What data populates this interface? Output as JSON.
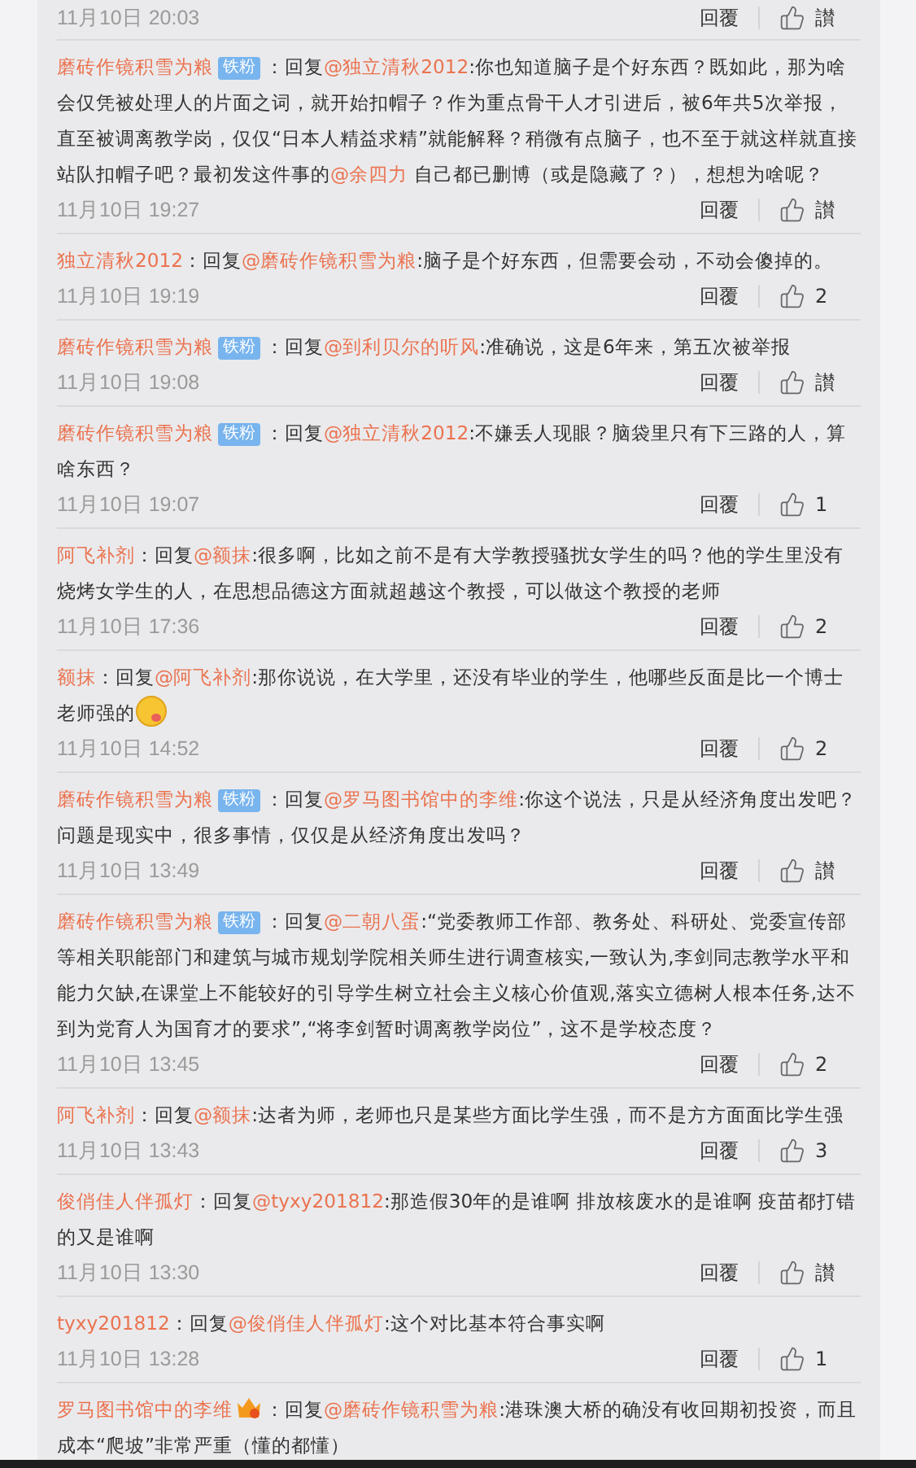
{
  "partial_footer": {
    "date": "11月10日 20:03",
    "reply": "回覆",
    "likes": "讃"
  },
  "comments": [
    {
      "user": "磨砖作镜积雪为粮",
      "badge": {
        "kind": "fan",
        "label": "铁粉"
      },
      "prefix": "：回复",
      "parts": [
        {
          "kind": "mention",
          "text": "@独立清秋2012"
        },
        {
          "kind": "text",
          "text": ":你也知道脑子是个好东西？既如此，那为啥会仅凭被处理人的片面之词，就开始扣帽子？作为重点骨干人才引进后，被6年共5次举报，直至被调离教学岗，仅仅“日本人精益求精”就能解释？稍微有点脑子，也不至于就这样就直接站队扣帽子吧？最初发这件事的"
        },
        {
          "kind": "mention",
          "text": "@余四力"
        },
        {
          "kind": "text",
          "text": " 自己都已删博（或是隐藏了？），想想为啥呢？"
        }
      ],
      "date": "11月10日 19:27",
      "reply": "回覆",
      "likes": "讃"
    },
    {
      "user": "独立清秋2012",
      "prefix": "：回复",
      "parts": [
        {
          "kind": "mention",
          "text": "@磨砖作镜积雪为粮"
        },
        {
          "kind": "text",
          "text": ":脑子是个好东西，但需要会动，不动会傻掉的。"
        }
      ],
      "date": "11月10日 19:19",
      "reply": "回覆",
      "likes": "2"
    },
    {
      "user": "磨砖作镜积雪为粮",
      "badge": {
        "kind": "fan",
        "label": "铁粉"
      },
      "prefix": "：回复",
      "parts": [
        {
          "kind": "mention",
          "text": "@到利贝尔的听风"
        },
        {
          "kind": "text",
          "text": ":准确说，这是6年来，第五次被举报"
        }
      ],
      "date": "11月10日 19:08",
      "reply": "回覆",
      "likes": "讃"
    },
    {
      "user": "磨砖作镜积雪为粮",
      "badge": {
        "kind": "fan",
        "label": "铁粉"
      },
      "prefix": "：回复",
      "parts": [
        {
          "kind": "mention",
          "text": "@独立清秋2012"
        },
        {
          "kind": "text",
          "text": ":不嫌丢人现眼？脑袋里只有下三路的人，算啥东西？"
        }
      ],
      "date": "11月10日 19:07",
      "reply": "回覆",
      "likes": "1"
    },
    {
      "user": "阿飞补剂",
      "prefix": "：回复",
      "parts": [
        {
          "kind": "mention",
          "text": "@额抹"
        },
        {
          "kind": "text",
          "text": ":很多啊，比如之前不是有大学教授骚扰女学生的吗？他的学生里没有烧烤女学生的人，在思想品德这方面就超越这个教授，可以做这个教授的老师"
        }
      ],
      "date": "11月10日 17:36",
      "reply": "回覆",
      "likes": "2"
    },
    {
      "user": "额抹",
      "prefix": "：回复",
      "parts": [
        {
          "kind": "mention",
          "text": "@阿飞补剂"
        },
        {
          "kind": "text",
          "text": ":那你说说，在大学里，还没有毕业的学生，他哪些反面是比一个博士老师强的"
        },
        {
          "kind": "emoji"
        }
      ],
      "date": "11月10日 14:52",
      "reply": "回覆",
      "likes": "2"
    },
    {
      "user": "磨砖作镜积雪为粮",
      "badge": {
        "kind": "fan",
        "label": "铁粉"
      },
      "prefix": "：回复",
      "parts": [
        {
          "kind": "mention",
          "text": "@罗马图书馆中的李维"
        },
        {
          "kind": "text",
          "text": ":你这个说法，只是从经济角度出发吧？问题是现实中，很多事情，仅仅是从经济角度出发吗？"
        }
      ],
      "date": "11月10日 13:49",
      "reply": "回覆",
      "likes": "讃"
    },
    {
      "user": "磨砖作镜积雪为粮",
      "badge": {
        "kind": "fan",
        "label": "铁粉"
      },
      "prefix": "：回复",
      "parts": [
        {
          "kind": "mention",
          "text": "@二朝八蛋"
        },
        {
          "kind": "text",
          "text": ":“党委教师工作部、教务处、科研处、党委宣传部等相关职能部门和建筑与城市规划学院相关师生进行调查核实,一致认为,李剑同志教学水平和能力欠缺,在课堂上不能较好的引导学生树立社会主义核心价值观,落实立德树人根本任务,达不到为党育人为国育才的要求”,“将李剑暂时调离教学岗位”，这不是学校态度？"
        }
      ],
      "date": "11月10日 13:45",
      "reply": "回覆",
      "likes": "2"
    },
    {
      "user": "阿飞补剂",
      "prefix": "：回复",
      "parts": [
        {
          "kind": "mention",
          "text": "@额抹"
        },
        {
          "kind": "text",
          "text": ":达者为师，老师也只是某些方面比学生强，而不是方方面面比学生强"
        }
      ],
      "date": "11月10日 13:43",
      "reply": "回覆",
      "likes": "3"
    },
    {
      "user": "俊俏佳人伴孤灯",
      "prefix": "：回复",
      "parts": [
        {
          "kind": "mention",
          "text": "@tyxy201812"
        },
        {
          "kind": "text",
          "text": ":那造假30年的是谁啊 排放核废水的是谁啊 疫苗都打错的又是谁啊"
        }
      ],
      "date": "11月10日 13:30",
      "reply": "回覆",
      "likes": "讃"
    },
    {
      "user": "tyxy201812",
      "prefix": "：回复",
      "parts": [
        {
          "kind": "mention",
          "text": "@俊俏佳人伴孤灯"
        },
        {
          "kind": "text",
          "text": ":这个对比基本符合事实啊"
        }
      ],
      "date": "11月10日 13:28",
      "reply": "回覆",
      "likes": "1"
    },
    {
      "user": "罗马图书馆中的李维",
      "badge": {
        "kind": "crown"
      },
      "prefix": "：回复",
      "parts": [
        {
          "kind": "mention",
          "text": "@磨砖作镜积雪为粮"
        },
        {
          "kind": "text",
          "text": ":港珠澳大桥的确没有收回期初投资，而且成本“爬坡”非常严重（懂的都懂）"
        }
      ]
    }
  ]
}
